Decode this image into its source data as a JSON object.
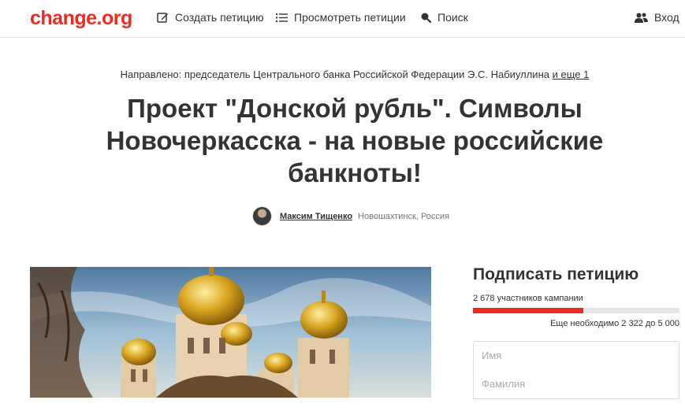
{
  "header": {
    "logo": "change.org",
    "nav": {
      "create": "Создать петицию",
      "browse": "Просмотреть петиции",
      "search": "Поиск",
      "login": "Вход"
    }
  },
  "petition": {
    "directed_prefix": "Направлено: председатель Центрального банка Российской Федерации Э.С. Набиуллина",
    "directed_more": "и еще 1",
    "title_lines": [
      "Проект \"Донской рубль\". Символы",
      "Новочеркасска - на новые российские",
      "банкноты!"
    ],
    "author_name": "Максим Тищенко",
    "author_location": "Новошахтинск, Россия"
  },
  "sign": {
    "title": "Подписать петицию",
    "supporters": "2 678 участников кампании",
    "needed": "Еще необходимо 2 322 до 5 000",
    "progress_fraction": 0.5356,
    "first_name_placeholder": "Имя",
    "last_name_placeholder": "Фамилия"
  },
  "colors": {
    "brand": "#ec2c22",
    "text": "#333333"
  },
  "icons": {
    "create": "pencil-square-icon",
    "browse": "list-icon",
    "search": "search-icon",
    "login": "users-icon"
  }
}
